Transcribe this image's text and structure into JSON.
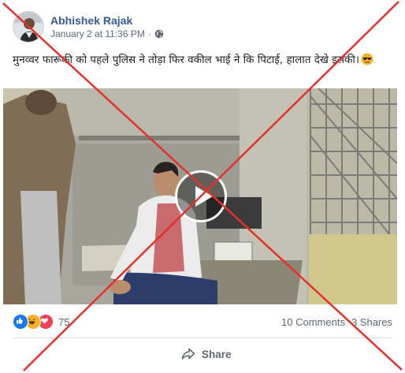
{
  "post": {
    "author": "Abhishek Rajak",
    "timestamp": "January 2 at 11:36 PM",
    "separator": "·",
    "privacy_icon": "globe-icon",
    "caption": "मुनव्वर फारूकी को पहले पुलिस ने तोड़ा फिर वकील भाई ने कि पिटाई, हालात देखे इसकी।",
    "caption_emoji": "sunglasses-emoji"
  },
  "video": {
    "play_icon": "play-icon"
  },
  "stats": {
    "reaction_icons": [
      "like-icon",
      "haha-icon",
      "love-icon"
    ],
    "reaction_count": "75",
    "comments": "10 Comments",
    "shares": "3 Shares"
  },
  "actions": {
    "share_label": "Share",
    "share_icon": "share-arrow-icon"
  },
  "overlay": {
    "mark": "red-x-cross",
    "color": "#e5312b"
  },
  "colors": {
    "author": "#385898",
    "secondary": "#606770",
    "text": "#1c1e21",
    "like": "#1877f2",
    "haha": "#f7b125",
    "love": "#f33e58"
  }
}
